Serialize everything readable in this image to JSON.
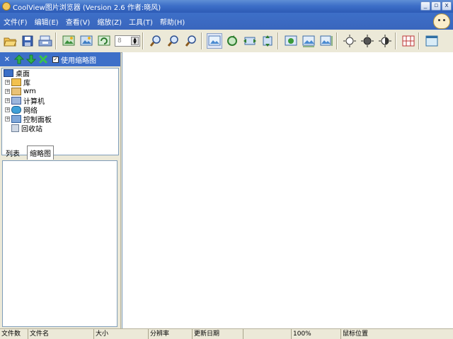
{
  "window": {
    "title": "CoolView图片浏览器 (Version 2.6  作者:晓风)",
    "controls": [
      "_",
      "▫",
      "x"
    ]
  },
  "menu": {
    "items": [
      "文件(F)",
      "编辑(E)",
      "查看(V)",
      "缩放(Z)",
      "工具(T)",
      "帮助(H)"
    ]
  },
  "toolbar": {
    "zoom_value": "8",
    "buttons": [
      "open-folder-icon",
      "save-icon",
      "batch-convert-icon",
      "image-prev-icon",
      "image-next-icon",
      "image-refresh-icon",
      "zoom-in-icon",
      "zoom-out-icon",
      "zoom-fit-icon",
      "picture-icon",
      "rotate-icon",
      "flip-horizontal-icon",
      "flip-vertical-icon",
      "picture-edit-icon",
      "picture-resize-icon",
      "picture-crop-icon",
      "brightness-up-icon",
      "brightness-down-icon",
      "contrast-icon",
      "grid-icon",
      "fullscreen-icon"
    ]
  },
  "left_panel": {
    "use_thumbnails_label": "使用缩略图",
    "tree": [
      {
        "label": "桌面",
        "level": 0,
        "expandable": false
      },
      {
        "label": "库",
        "level": 1,
        "expandable": true
      },
      {
        "label": "wm",
        "level": 1,
        "expandable": true
      },
      {
        "label": "计算机",
        "level": 1,
        "expandable": true
      },
      {
        "label": "网络",
        "level": 1,
        "expandable": true
      },
      {
        "label": "控制面板",
        "level": 1,
        "expandable": true
      },
      {
        "label": "回收站",
        "level": 1,
        "expandable": false
      }
    ],
    "tabs": [
      "列表",
      "缩略图"
    ],
    "active_tab": "缩略图"
  },
  "statusbar": {
    "cells": [
      "文件数",
      "文件名",
      "大小",
      "分辨率",
      "更新日期",
      "",
      "100%",
      "鼠标位置"
    ]
  },
  "colors": {
    "title_blue": "#3d6fc8",
    "panel_bg": "#ece9d8"
  }
}
